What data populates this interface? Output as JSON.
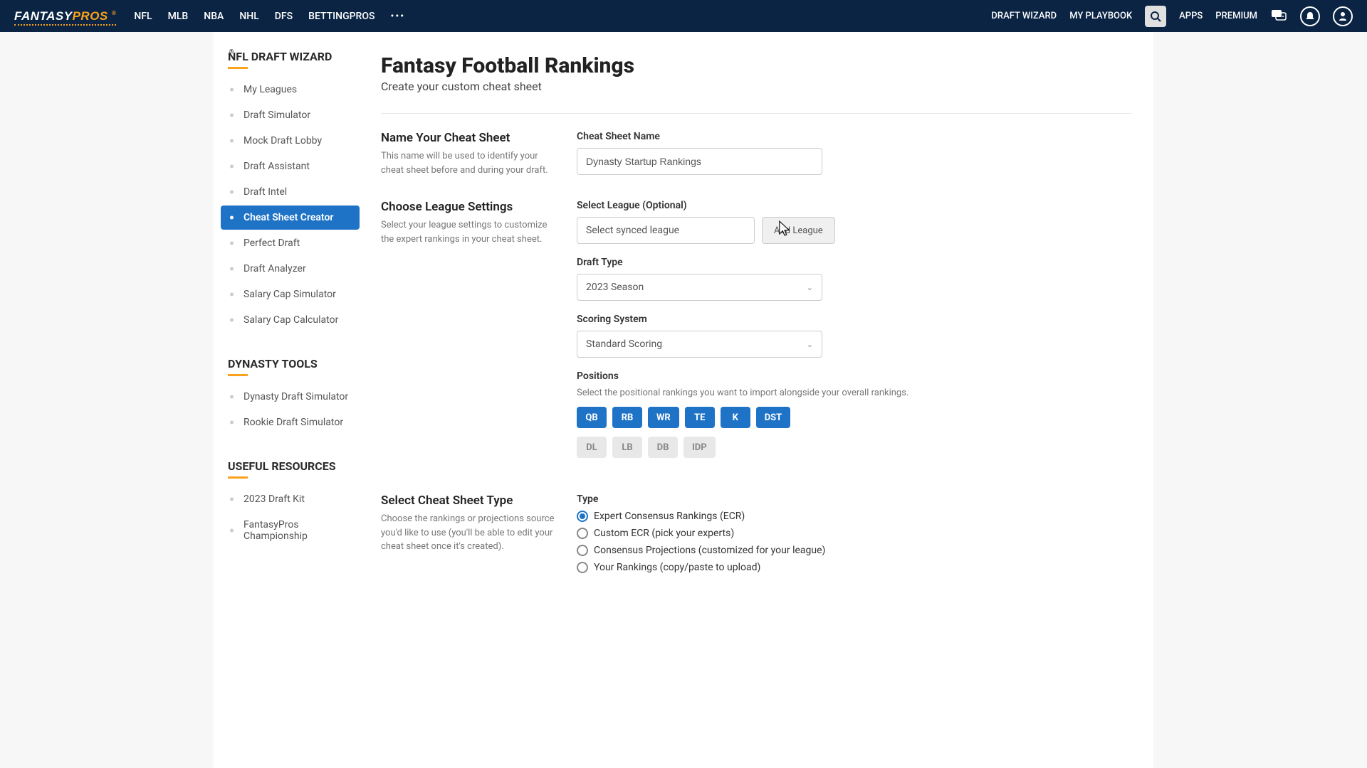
{
  "brand": {
    "part1": "FANTASY",
    "part2": "PROS"
  },
  "topnav": {
    "left": [
      "NFL",
      "MLB",
      "NBA",
      "NHL",
      "DFS",
      "BETTINGPROS"
    ],
    "right": [
      "DRAFT WIZARD",
      "MY PLAYBOOK"
    ],
    "apps": "APPS",
    "premium": "PREMIUM"
  },
  "sidebar": {
    "groups": [
      {
        "title": "NFL DRAFT WIZARD",
        "reg": true,
        "items": [
          "My Leagues",
          "Draft Simulator",
          "Mock Draft Lobby",
          "Draft Assistant",
          "Draft Intel",
          "Cheat Sheet Creator",
          "Perfect Draft",
          "Draft Analyzer",
          "Salary Cap Simulator",
          "Salary Cap Calculator"
        ],
        "active_index": 5
      },
      {
        "title": "DYNASTY TOOLS",
        "reg": false,
        "items": [
          "Dynasty Draft Simulator",
          "Rookie Draft Simulator"
        ],
        "active_index": -1
      },
      {
        "title": "USEFUL RESOURCES",
        "reg": false,
        "items": [
          "2023 Draft Kit",
          "FantasyPros Championship"
        ],
        "active_index": -1
      }
    ]
  },
  "header": {
    "title": "Fantasy Football Rankings",
    "subtitle": "Create your custom cheat sheet"
  },
  "name_section": {
    "heading": "Name Your Cheat Sheet",
    "desc": "This name will be used to identify your cheat sheet before and during your draft.",
    "field_label": "Cheat Sheet Name",
    "value": "Dynasty Startup Rankings"
  },
  "league_section": {
    "heading": "Choose League Settings",
    "desc": "Select your league settings to customize the expert rankings in your cheat sheet.",
    "select_label": "Select League (Optional)",
    "select_placeholder": "Select synced league",
    "add_button": "Add League",
    "draft_type_label": "Draft Type",
    "draft_type_value": "2023 Season",
    "scoring_label": "Scoring System",
    "scoring_value": "Standard Scoring",
    "positions_label": "Positions",
    "positions_sublabel": "Select the positional rankings you want to import alongside your overall rankings.",
    "positions": [
      {
        "label": "QB",
        "on": true
      },
      {
        "label": "RB",
        "on": true
      },
      {
        "label": "WR",
        "on": true
      },
      {
        "label": "TE",
        "on": true
      },
      {
        "label": "K",
        "on": true
      },
      {
        "label": "DST",
        "on": true
      },
      {
        "label": "DL",
        "on": false
      },
      {
        "label": "LB",
        "on": false
      },
      {
        "label": "DB",
        "on": false
      },
      {
        "label": "IDP",
        "on": false
      }
    ]
  },
  "type_section": {
    "heading": "Select Cheat Sheet Type",
    "desc": "Choose the rankings or projections source you'd like to use (you'll be able to edit your cheat sheet once it's created).",
    "type_label": "Type",
    "options": [
      "Expert Consensus Rankings (ECR)",
      "Custom ECR (pick your experts)",
      "Consensus Projections (customized for your league)",
      "Your Rankings (copy/paste to upload)"
    ],
    "selected_index": 0
  }
}
